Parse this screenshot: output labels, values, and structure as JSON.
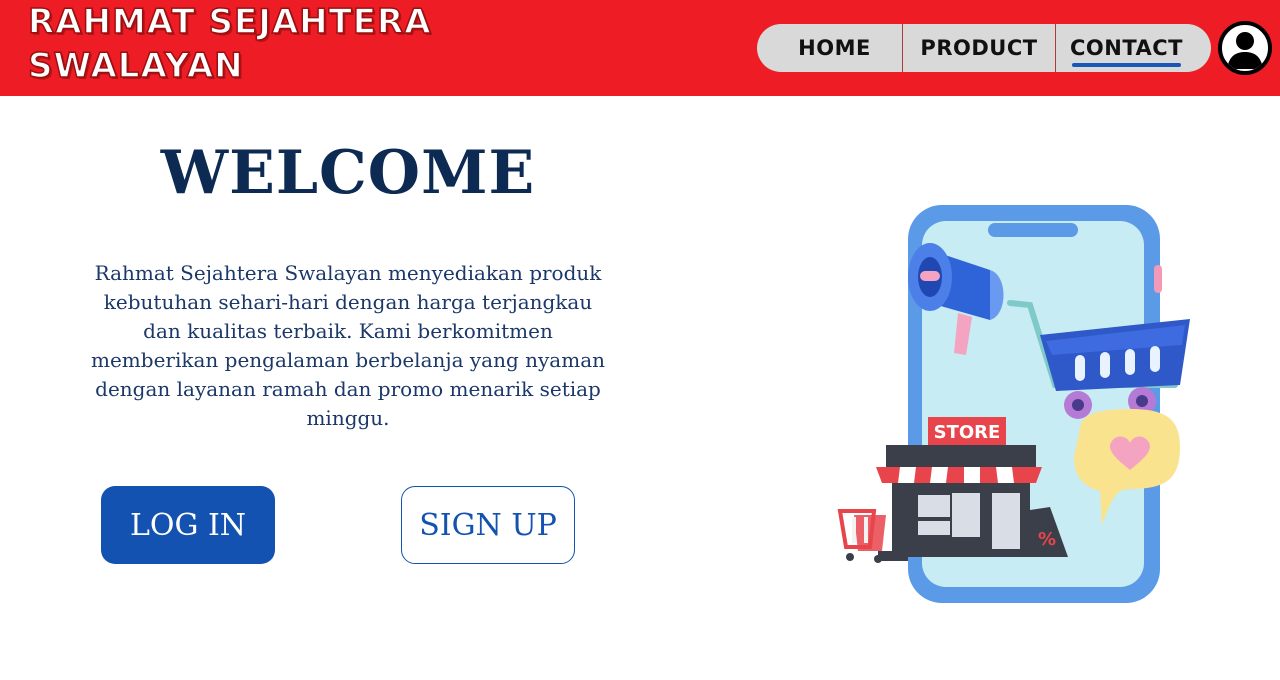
{
  "header": {
    "brand_line1": "RAHMAT SEJAHTERA",
    "brand_line2": "SWALAYAN",
    "bg_color": "#ee1c25"
  },
  "nav": {
    "items": [
      {
        "label": "HOME",
        "active": false
      },
      {
        "label": "PRODUCT",
        "active": false
      },
      {
        "label": "CONTACT",
        "active": true
      }
    ],
    "active_underline_color": "#1a56b8",
    "user_icon": "user-icon"
  },
  "hero": {
    "title": "WELCOME",
    "description": "Rahmat Sejahtera Swalayan menyediakan produk kebutuhan sehari-hari dengan harga terjangkau dan kualitas terbaik. Kami berkomitmen memberikan pengalaman berbelanja yang nyaman dengan layanan ramah dan promo menarik setiap minggu.",
    "login_label": "LOG IN",
    "signup_label": "SIGN UP",
    "title_color": "#0c2a52",
    "button_color": "#1352b0"
  },
  "illustration": {
    "store_sign": "STORE",
    "discount_tag": "%"
  }
}
